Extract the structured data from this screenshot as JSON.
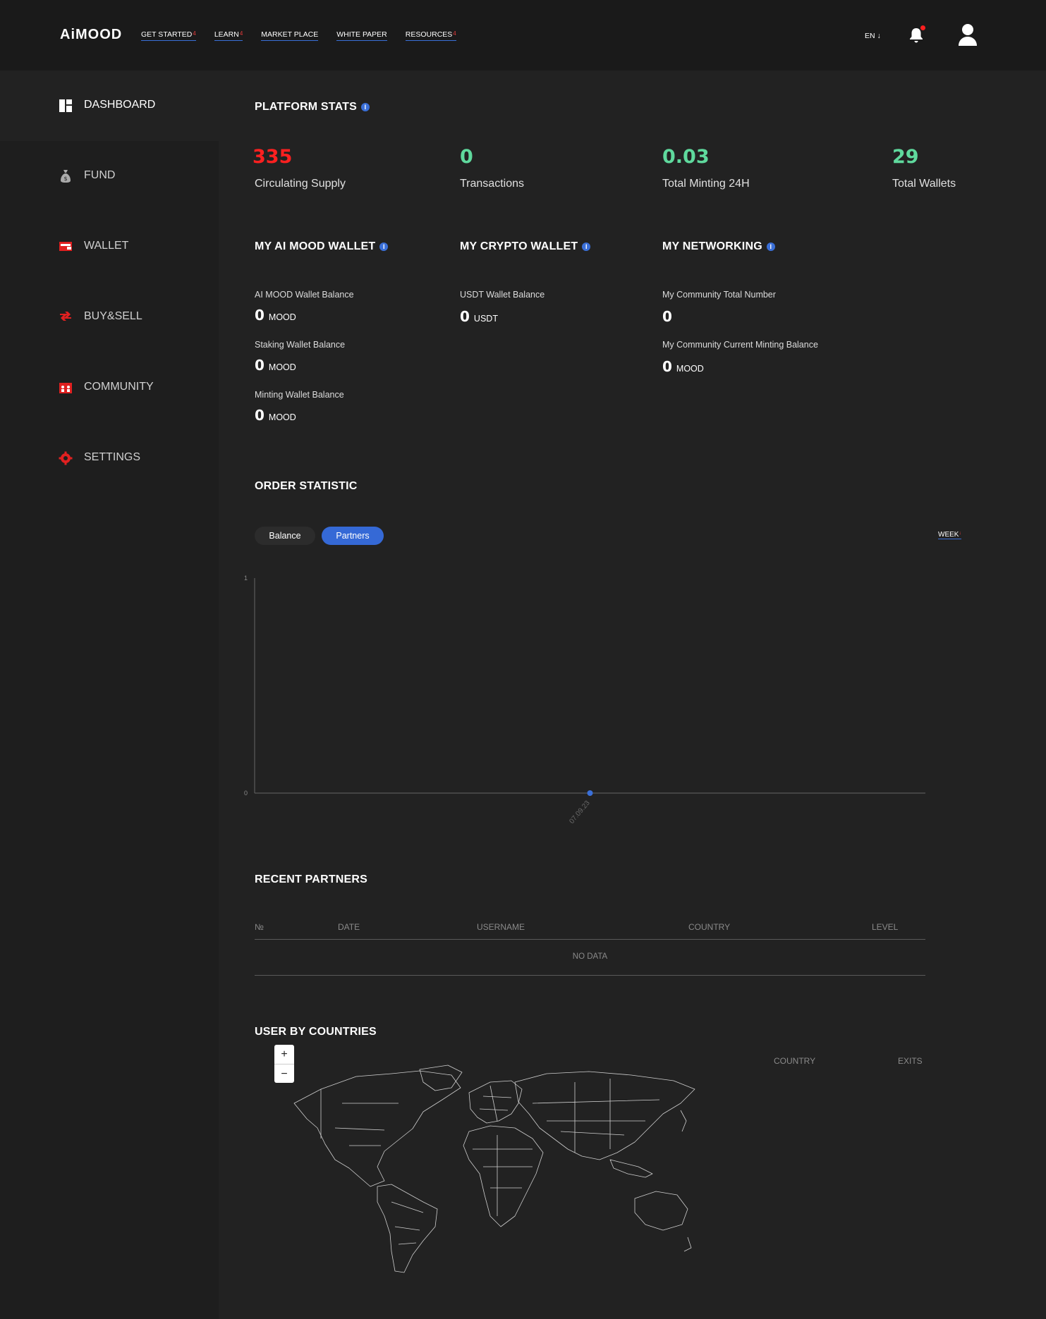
{
  "header": {
    "logo_text": "AiMOOD",
    "nav": [
      {
        "label": "GET STARTED",
        "mark": "4"
      },
      {
        "label": "LEARN",
        "mark": "4"
      },
      {
        "label": "MARKET PLACE",
        "mark": ""
      },
      {
        "label": "WHITE PAPER",
        "mark": ""
      },
      {
        "label": "RESOURCES",
        "mark": "4"
      }
    ],
    "language": "EN ↓",
    "notification_dot_color": "#ff1f1f"
  },
  "sidebar": {
    "items": [
      {
        "label": "DASHBOARD",
        "icon": "dashboard-icon"
      },
      {
        "label": "FUND",
        "icon": "money-bag-icon"
      },
      {
        "label": "WALLET",
        "icon": "wallet-icon"
      },
      {
        "label": "BUY&SELL",
        "icon": "exchange-icon"
      },
      {
        "label": "COMMUNITY",
        "icon": "community-icon"
      },
      {
        "label": "SETTINGS",
        "icon": "gear-icon"
      }
    ]
  },
  "platform_stats": {
    "title": "PLATFORM STATS",
    "stats": [
      {
        "value": "335",
        "label": "Circulating Supply"
      },
      {
        "value": "0",
        "label": "Transactions"
      },
      {
        "value": "0.03",
        "label": "Total Minting 24H"
      },
      {
        "value": "29",
        "label": "Total Wallets"
      }
    ]
  },
  "ai_mood_wallet": {
    "title": "MY AI MOOD WALLET",
    "rows": [
      {
        "label": "AI MOOD Wallet Balance",
        "value": "0",
        "unit": "MOOD"
      },
      {
        "label": "Staking Wallet Balance",
        "value": "0",
        "unit": "MOOD"
      },
      {
        "label": "Minting Wallet Balance",
        "value": "0",
        "unit": "MOOD"
      }
    ]
  },
  "crypto_wallet": {
    "title": "MY CRYPTO WALLET",
    "rows": [
      {
        "label": "USDT Wallet Balance",
        "value": "0",
        "unit": "USDT"
      }
    ]
  },
  "networking": {
    "title": "MY NETWORKING",
    "rows": [
      {
        "label": "My Community Total Number",
        "value": "0",
        "unit": ""
      },
      {
        "label": "My Community Current Minting Balance",
        "value": "0",
        "unit": "MOOD"
      }
    ]
  },
  "order_statistic": {
    "title": "ORDER STATISTIC",
    "tabs": [
      "Balance",
      "Partners"
    ],
    "active_tab": "Partners",
    "period": "WEEK",
    "period_mark": "↓"
  },
  "chart_data": {
    "type": "line",
    "x": [
      "07.09.23"
    ],
    "series": [
      {
        "values": [
          0
        ]
      }
    ],
    "ylim": [
      0,
      1
    ],
    "yticks": [
      "0",
      "1"
    ],
    "point_color": "#3a6fd8"
  },
  "recent_partners": {
    "title": "RECENT PARTNERS",
    "columns": [
      "№",
      "DATE",
      "USERNAME",
      "COUNTRY",
      "LEVEL"
    ],
    "empty_text": "NO DATA"
  },
  "user_by_countries": {
    "title": "USER BY COUNTRIES",
    "zoom_in": "+",
    "zoom_out": "−",
    "columns": [
      "COUNTRY",
      "EXITS"
    ]
  }
}
